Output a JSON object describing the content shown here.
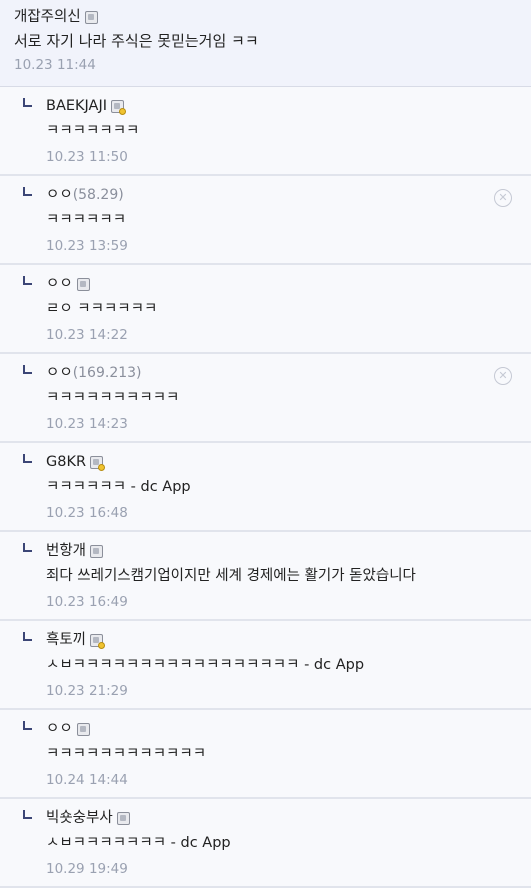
{
  "parent_comment": {
    "nick": "개잡주의신",
    "text": "서로 자기 나라 주식은 못믿는거임 ㅋㅋ",
    "date": "10.23 11:44"
  },
  "replies": [
    {
      "nick": "BAEKJAJI",
      "ip": "",
      "badge": "gold",
      "text": "ㅋㅋㅋㅋㅋㅋㅋ",
      "date": "10.23 11:50",
      "deletable": false
    },
    {
      "nick": "ㅇㅇ",
      "ip": "(58.29)",
      "badge": "none",
      "text": "ㅋㅋㅋㅋㅋㅋ",
      "date": "10.23 13:59",
      "deletable": true
    },
    {
      "nick": "ㅇㅇ",
      "ip": "",
      "badge": "gray",
      "text": "ㄹㅇ ㅋㅋㅋㅋㅋㅋ",
      "date": "10.23 14:22",
      "deletable": false
    },
    {
      "nick": "ㅇㅇ",
      "ip": "(169.213)",
      "badge": "none",
      "text": "ㅋㅋㅋㅋㅋㅋㅋㅋㅋㅋ",
      "date": "10.23 14:23",
      "deletable": true
    },
    {
      "nick": "G8KR",
      "ip": "",
      "badge": "gold",
      "text": "ㅋㅋㅋㅋㅋㅋ - dc App",
      "date": "10.23 16:48",
      "deletable": false
    },
    {
      "nick": "번항개",
      "ip": "",
      "badge": "gray",
      "text": "죄다 쓰레기스캠기업이지만 세계 경제에는 활기가 돋았습니다",
      "date": "10.23 16:49",
      "deletable": false
    },
    {
      "nick": "흑토끼",
      "ip": "",
      "badge": "gold",
      "text": "ㅅㅂㅋㅋㅋㅋㅋㅋㅋㅋㅋㅋㅋㅋㅋㅋㅋㅋㅋ - dc App",
      "date": "10.23 21:29",
      "deletable": false
    },
    {
      "nick": "ㅇㅇ",
      "ip": "",
      "badge": "gray",
      "text": "ㅋㅋㅋㅋㅋㅋㅋㅋㅋㅋㅋㅋ",
      "date": "10.24 14:44",
      "deletable": false
    },
    {
      "nick": "빅숏숭부사",
      "ip": "",
      "badge": "gray",
      "text": "ㅅㅂㅋㅋㅋㅋㅋㅋㅋ - dc App",
      "date": "10.29 19:49",
      "deletable": false
    }
  ],
  "icons": {
    "delete": "delete-circle-icon",
    "reply": "reply-arrow-icon",
    "user_badge": "user-badge-icon"
  },
  "colors": {
    "accent": "#3c4676",
    "parent_bg": "#f1f3fb",
    "reply_bg": "#f8f9fc",
    "date": "#9aa1b1"
  }
}
